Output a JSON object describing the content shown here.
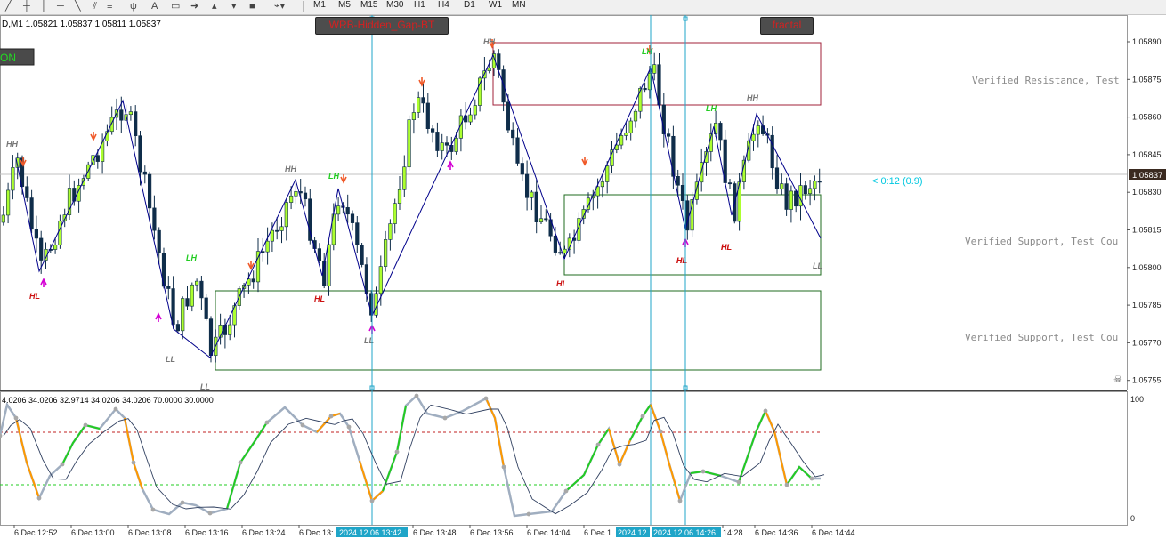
{
  "toolbar": {
    "icons": [
      "cursor-icon",
      "crosshair-icon",
      "vertical-line-icon",
      "horizontal-line-icon",
      "trendline-icon",
      "channel-icon",
      "fibonacci-icon",
      "text-icon",
      "label-icon",
      "arrow-icon",
      "rectangle-icon",
      "shapes-dropdown-icon"
    ],
    "text_tool": "A",
    "timeframes": [
      "M1",
      "M5",
      "M15",
      "M30",
      "H1",
      "H4",
      "D1",
      "W1",
      "MN"
    ]
  },
  "chart": {
    "ohlc_header": "D,M1  1.05821 1.05837 1.05811 1.05837",
    "on_label": "ON",
    "wrb_button": "WRB-Hidden_Gap-BT",
    "fractal_button": "fractal",
    "countdown": "< 0:12 (0.9)",
    "current_price": "1.05837",
    "zone_labels": [
      "Verified Resistance, Test",
      "Verified Support, Test Cou",
      "Verified Support, Test Cou"
    ],
    "price_ticks": [
      "1.05890",
      "1.05875",
      "1.05860",
      "1.05845",
      "1.05830",
      "1.05815",
      "1.05800",
      "1.05785",
      "1.05770",
      "1.05755"
    ],
    "swing_labels": [
      "HH",
      "HL",
      "LL",
      "LH",
      "HL",
      "HH",
      "LH",
      "HL",
      "LL",
      "HL",
      "LL",
      "HH",
      "HL",
      "LH",
      "LH",
      "HL",
      "HL",
      "HH",
      "LL"
    ],
    "time_ticks": [
      "6 Dec 12:52",
      "6 Dec 13:00",
      "6 Dec 13:08",
      "6 Dec 13:16",
      "6 Dec 13:24",
      "6 Dec 13:",
      "6 Dec 13:48",
      "6 Dec 13:56",
      "6 Dec 14:04",
      "6 Dec 1",
      "14:28",
      "6 Dec 14:36",
      "6 Dec 14:44"
    ],
    "crosshair_times": [
      "2024.12.06 13:42",
      "2024.12.",
      "2024.12.06 14:26"
    ]
  },
  "indicator": {
    "header": "4.0206 34.0206 32.9714 34.0206 34.0206 70.0000 30.0000",
    "levels": [
      "100",
      "0"
    ]
  },
  "colors": {
    "bull_candle": "#adff2f",
    "bear_candle": "#0f2d4a",
    "zigzag": "#00008b",
    "resistance_zone": "#a0203a",
    "support_zone": "#1f6b1f",
    "crosshair": "#1fa5c8",
    "up_arrow": "#d400d4",
    "down_arrow": "#f05a2a"
  }
}
